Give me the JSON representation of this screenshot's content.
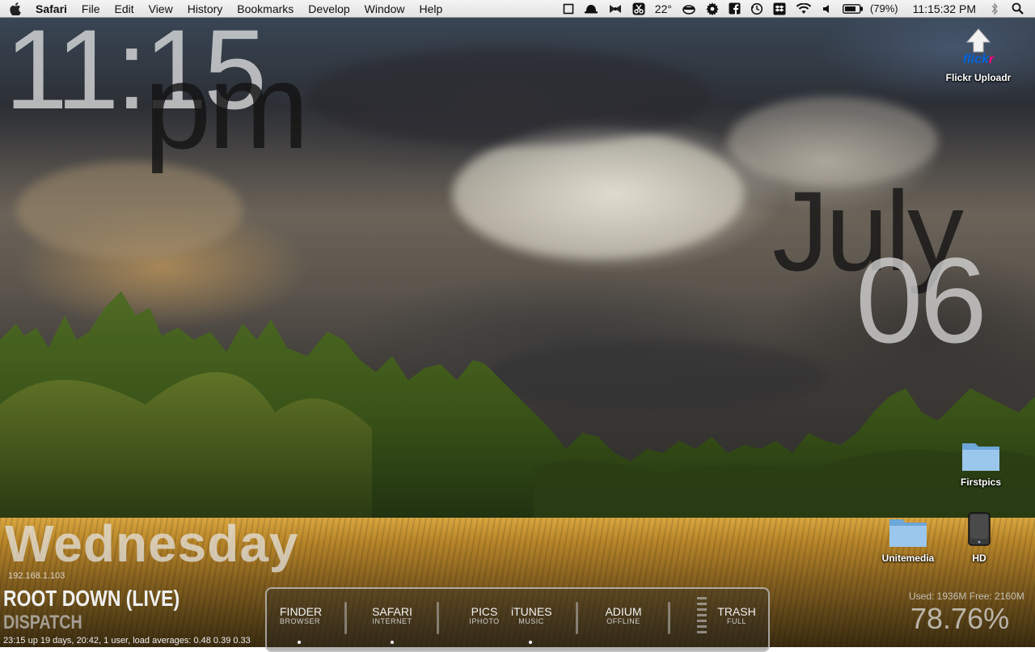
{
  "menubar": {
    "app_name": "Safari",
    "menus": [
      "File",
      "Edit",
      "View",
      "History",
      "Bookmarks",
      "Develop",
      "Window",
      "Help"
    ],
    "status": {
      "temperature": "22°",
      "battery": "(79%)",
      "time": "11:15:32 PM"
    },
    "icons": [
      "apple-icon",
      "square-icon",
      "hat-icon",
      "bow-icon",
      "scissors-icon",
      "tea-icon",
      "gear-icon",
      "facebook-icon",
      "time-machine-icon",
      "dropbox-icon",
      "wifi-icon",
      "volume-icon",
      "battery-icon",
      "bluetooth-icon",
      "spotlight-icon"
    ]
  },
  "clock": {
    "hour": "11:15",
    "ampm": "pm"
  },
  "date": {
    "month": "July",
    "day": "06",
    "weekday": "Wednesday"
  },
  "system": {
    "ip": "192.168.1.103",
    "uptime": "23:15  up 19 days, 20:42, 1 user, load averages: 0.48 0.39 0.33",
    "memory_line": "Used: 1936M  Free: 2160M",
    "memory_percent": "78.76%"
  },
  "now_playing": {
    "title": "ROOT DOWN (LIVE)",
    "artist": "DISPATCH"
  },
  "dock": {
    "items": [
      {
        "label": "FINDER",
        "sub": "BROWSER"
      },
      {
        "label": "SAFARI",
        "sub": "INTERNET"
      },
      {
        "label": "PICS",
        "sub": "IPHOTO"
      },
      {
        "label": "iTUNES",
        "sub": "MUSIC"
      },
      {
        "label": "ADIUM",
        "sub": "OFFLINE"
      },
      {
        "label": "TRASH",
        "sub": "FULL"
      }
    ]
  },
  "desktop_icons": [
    {
      "label": "Flickr Uploadr",
      "icon": "flickr-uploadr-icon",
      "logo_text": "flickr"
    },
    {
      "label": "Firstpics",
      "icon": "folder-icon"
    },
    {
      "label": "Unitemedia",
      "icon": "folder-icon"
    },
    {
      "label": "HD",
      "icon": "hard-drive-icon"
    }
  ],
  "colors": {
    "flickr_blue": "#0063dc",
    "flickr_pink": "#ff0084",
    "folder_blue": "#7fb3e0"
  }
}
